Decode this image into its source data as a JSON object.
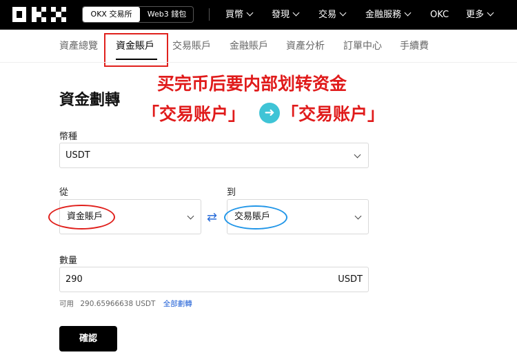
{
  "header": {
    "mode_exchange": "OKX 交易所",
    "mode_web3": "Web3 錢包",
    "nav": [
      {
        "label": "買幣",
        "has_menu": true
      },
      {
        "label": "發現",
        "has_menu": true
      },
      {
        "label": "交易",
        "has_menu": true
      },
      {
        "label": "金融服務",
        "has_menu": true
      },
      {
        "label": "OKC",
        "has_menu": false
      },
      {
        "label": "更多",
        "has_menu": true
      }
    ]
  },
  "tabs": [
    {
      "label": "資產總覽",
      "active": false
    },
    {
      "label": "資金賬戶",
      "active": true
    },
    {
      "label": "交易賬戶",
      "active": false
    },
    {
      "label": "金融賬戶",
      "active": false
    },
    {
      "label": "資產分析",
      "active": false
    },
    {
      "label": "訂單中心",
      "active": false
    },
    {
      "label": "手續費",
      "active": false
    }
  ],
  "annotation": {
    "line1": "买完币后要内部划转资金",
    "from": "「交易账户」",
    "arrow": "➜",
    "to": "「交易账户」",
    "color": "#e01b1b"
  },
  "transfer": {
    "title": "資金劃轉",
    "coin_label": "幣種",
    "coin_value": "USDT",
    "from_label": "從",
    "from_value": "資金賬戶",
    "to_label": "到",
    "to_value": "交易賬戶",
    "swap_icon": "⇄",
    "amount_label": "數量",
    "amount_value": "290",
    "amount_unit": "USDT",
    "available_label": "可用",
    "available_value": "290.65966638 USDT",
    "transfer_all": "全部劃轉",
    "confirm": "確認"
  },
  "colors": {
    "highlight_red": "#e0201c",
    "highlight_blue": "#2196e8",
    "link": "#1f5fd6",
    "arrow_circle": "#3fc4d6"
  }
}
